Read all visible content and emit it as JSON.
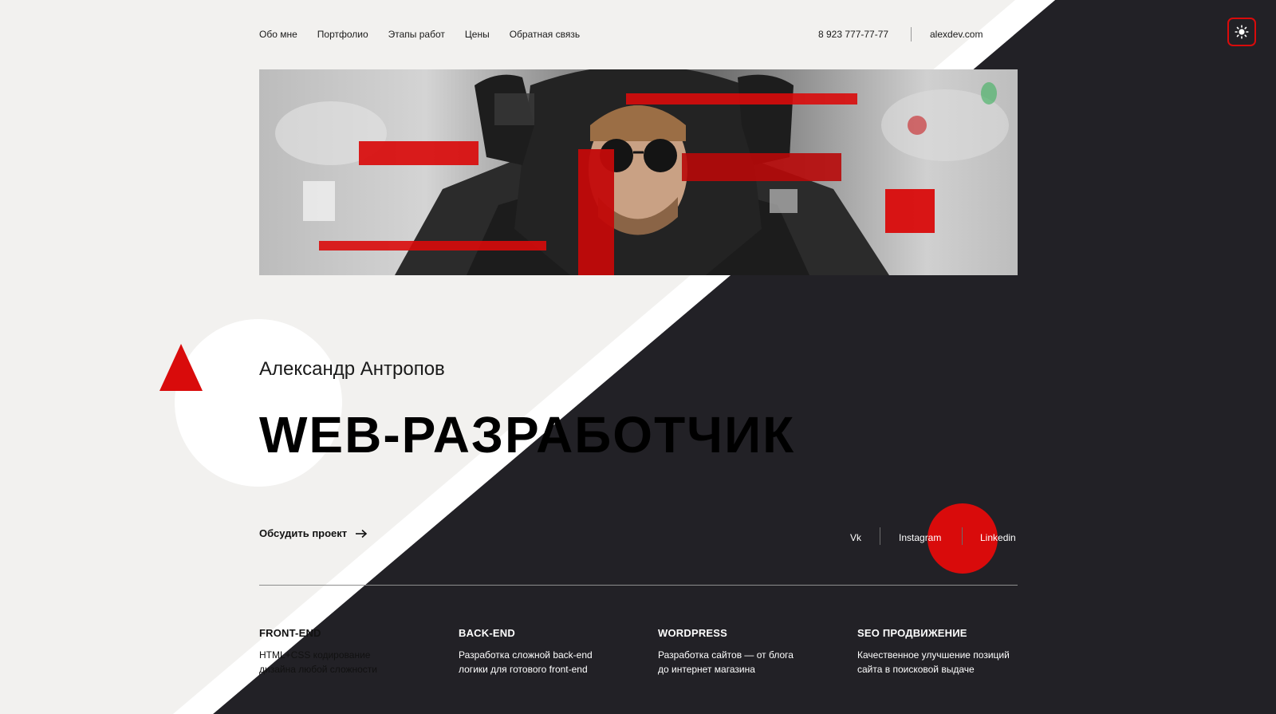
{
  "nav": {
    "items": [
      {
        "label": "Обо мне"
      },
      {
        "label": "Портфолио"
      },
      {
        "label": "Этапы работ"
      },
      {
        "label": "Цены"
      },
      {
        "label": "Обратная связь"
      }
    ]
  },
  "contacts": {
    "phone": "8 923 777-77-77",
    "email": "alexdev.com"
  },
  "theme_toggle": {
    "icon": "sun-icon"
  },
  "hero": {
    "name": "Александр Антропов",
    "title": "WEB-РАЗРАБОТЧИК"
  },
  "cta": {
    "label": "Обсудить проект"
  },
  "social": {
    "items": [
      {
        "label": "Vk"
      },
      {
        "label": "Instagram"
      },
      {
        "label": "Linkedin"
      }
    ]
  },
  "services": [
    {
      "title": "FRONT-END",
      "line1": "HTML+CSS кодирование",
      "line2": "дизайна любой сложности"
    },
    {
      "title": "BACK-END",
      "line1": "Разработка сложной back-end",
      "line2": "логики для готового front-end"
    },
    {
      "title": "WORDPRESS",
      "line1": "Разработка сайтов — от блога",
      "line2": "до интернет магазина"
    },
    {
      "title": "SEO ПРОДВИЖЕНИЕ",
      "line1": "Качественное улучшение позиций",
      "line2": "сайта в поисковой выдаче"
    }
  ],
  "colors": {
    "accent": "#d90b0b",
    "light_bg": "#f2f1ef",
    "dark_bg": "#222126"
  }
}
